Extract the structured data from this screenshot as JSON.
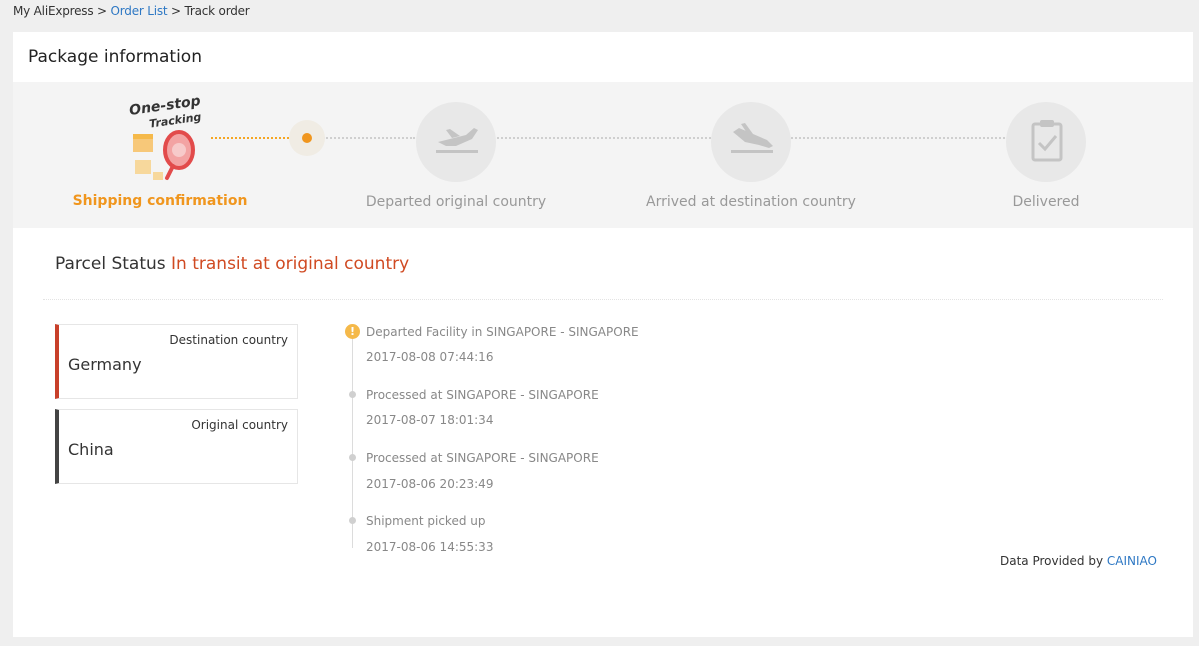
{
  "breadcrumb": {
    "home": "My AliExpress",
    "sep1": ">",
    "orders": "Order List",
    "sep2": ">",
    "current": "Track order"
  },
  "package": {
    "title": "Package information",
    "logo_line1": "One-stop",
    "logo_line2": "Tracking",
    "steps": [
      {
        "label": "Shipping confirmation",
        "state": "current"
      },
      {
        "label": "Departed original country",
        "state": "pending",
        "icon": "plane-takeoff-icon"
      },
      {
        "label": "Arrived at destination country",
        "state": "pending",
        "icon": "plane-landing-icon"
      },
      {
        "label": "Delivered",
        "state": "pending",
        "icon": "clipboard-check-icon"
      }
    ]
  },
  "parcel": {
    "label": "Parcel Status",
    "status": "In transit at original country",
    "destination": {
      "caption": "Destination country",
      "name": "Germany"
    },
    "origin": {
      "caption": "Original country",
      "name": "China"
    },
    "events": [
      {
        "text": "Departed Facility in SINGAPORE - SINGAPORE",
        "time": "2017-08-08 07:44:16"
      },
      {
        "text": "Processed at SINGAPORE - SINGAPORE",
        "time": "2017-08-07 18:01:34"
      },
      {
        "text": "Processed at SINGAPORE - SINGAPORE",
        "time": "2017-08-06 20:23:49"
      },
      {
        "text": "Shipment picked up",
        "time": "2017-08-06 14:55:33"
      }
    ],
    "alert_glyph": "!"
  },
  "footer": {
    "provided_by": "Data Provided by",
    "provider": "CAINIAO"
  },
  "colors": {
    "accent_orange": "#f0961e",
    "status_red": "#d04a22",
    "link_blue": "#2e78c4"
  }
}
